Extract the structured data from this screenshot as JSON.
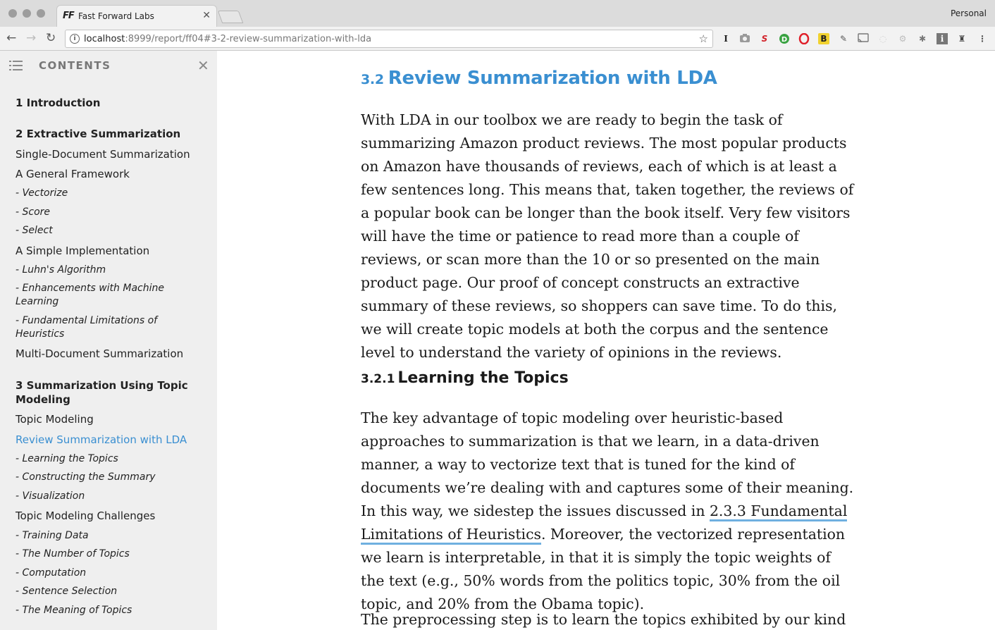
{
  "browser": {
    "tab_title": "Fast Forward Labs",
    "tab_icon": "FF",
    "profile": "Personal",
    "url_host": "localhost",
    "url_rest": ":8999/report/ff04#3-2-review-summarization-with-lda",
    "extensions": [
      "I",
      "camera",
      "S",
      "D",
      "O",
      "B",
      "pin",
      "cast",
      "circle",
      "gear",
      "bug",
      "i",
      "puzzle"
    ]
  },
  "sidebar": {
    "heading": "CONTENTS",
    "items": [
      {
        "label": "1 Introduction",
        "level": 1
      },
      {
        "label": "2 Extractive Summarization",
        "level": 1
      },
      {
        "label": "Single-Document Summarization",
        "level": 2
      },
      {
        "label": "A General Framework",
        "level": 2
      },
      {
        "label": "- Vectorize",
        "level": 3
      },
      {
        "label": "- Score",
        "level": 3
      },
      {
        "label": "- Select",
        "level": 3
      },
      {
        "label": "A Simple Implementation",
        "level": 2
      },
      {
        "label": "- Luhn's Algorithm",
        "level": 3
      },
      {
        "label": "- Enhancements with Machine Learning",
        "level": 3
      },
      {
        "label": "- Fundamental Limitations of Heuristics",
        "level": 3
      },
      {
        "label": "Multi-Document Summarization",
        "level": 2
      },
      {
        "label": "3 Summarization Using Topic Modeling",
        "level": 1
      },
      {
        "label": "Topic Modeling",
        "level": 2
      },
      {
        "label": "Review Summarization with LDA",
        "level": 2,
        "active": true
      },
      {
        "label": "- Learning the Topics",
        "level": 3
      },
      {
        "label": "- Constructing the Summary",
        "level": 3
      },
      {
        "label": "- Visualization",
        "level": 3
      },
      {
        "label": "Topic Modeling Challenges",
        "level": 2
      },
      {
        "label": "- Training Data",
        "level": 3
      },
      {
        "label": "- The Number of Topics",
        "level": 3
      },
      {
        "label": "- Computation",
        "level": 3
      },
      {
        "label": "- Sentence Selection",
        "level": 3
      },
      {
        "label": "- The Meaning of Topics",
        "level": 3
      }
    ]
  },
  "content": {
    "section_num": "3.2",
    "section_title": "Review Summarization with LDA",
    "para1": "With LDA in our toolbox we are ready to begin the task of summarizing Amazon product reviews. The most popular products on Amazon have thousands of reviews, each of which is at least a few sentences long. This means that, taken together, the reviews of a popular book can be longer than the book itself. Very few visitors will have the time or patience to read more than a couple of reviews, or scan more than the 10 or so presented on the main product page. Our proof of concept constructs an extractive summary of these reviews, so shoppers can save time. To do this, we will create topic models at both the corpus and the sentence level to understand the variety of opinions in the reviews.",
    "subsection_num": "3.2.1",
    "subsection_title": "Learning the Topics",
    "para2_before": "The key advantage of topic modeling over heuristic-based approaches to summarization is that we learn, in a data-driven manner, a way to vectorize text that is tuned for the kind of documents we’re dealing with and captures some of their meaning. In this way, we sidestep the issues discussed in ",
    "para2_link": "2.3.3 Fundamental Limitations of Heuristics",
    "para2_after": ". Moreover, the vectorized representation we learn is interpretable, in that it is simply the topic weights of the text (e.g., 50% words from the politics topic, 30% from the oil topic, and 20% from the Obama topic).",
    "para3": "The preprocessing step is to learn the topics exhibited by our kind of"
  }
}
